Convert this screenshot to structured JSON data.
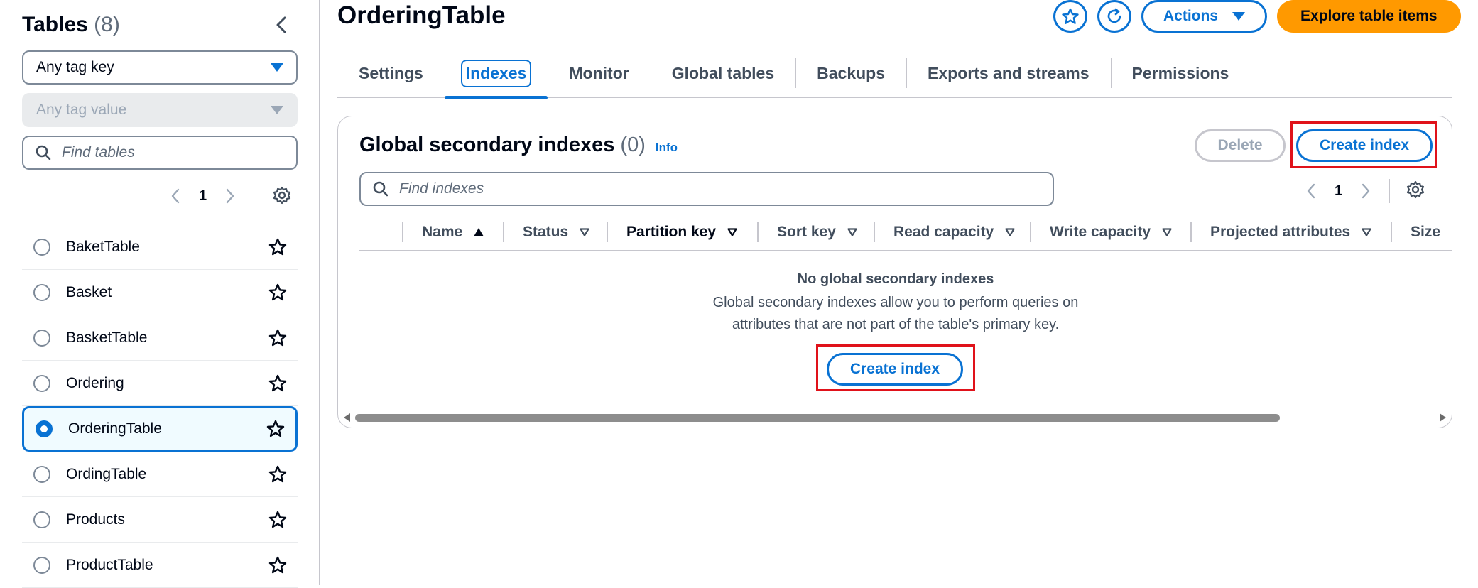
{
  "sidebar": {
    "title": "Tables",
    "count": "(8)",
    "tag_key_select": "Any tag key",
    "tag_value_select": "Any tag value",
    "search_placeholder": "Find tables",
    "page": "1",
    "tables": [
      {
        "name": "BaketTable",
        "selected": false
      },
      {
        "name": "Basket",
        "selected": false
      },
      {
        "name": "BasketTable",
        "selected": false
      },
      {
        "name": "Ordering",
        "selected": false
      },
      {
        "name": "OrderingTable",
        "selected": true
      },
      {
        "name": "OrdingTable",
        "selected": false
      },
      {
        "name": "Products",
        "selected": false
      },
      {
        "name": "ProductTable",
        "selected": false
      }
    ]
  },
  "header": {
    "title": "OrderingTable",
    "actions_label": "Actions",
    "explore_label": "Explore table items"
  },
  "tabs": [
    "Settings",
    "Indexes",
    "Monitor",
    "Global tables",
    "Backups",
    "Exports and streams",
    "Permissions"
  ],
  "active_tab": "Indexes",
  "gsi": {
    "title": "Global secondary indexes",
    "count": "(0)",
    "info": "Info",
    "delete_label": "Delete",
    "create_label": "Create index",
    "search_placeholder": "Find indexes",
    "page": "1",
    "columns": [
      "Name",
      "Status",
      "Partition key",
      "Sort key",
      "Read capacity",
      "Write capacity",
      "Projected attributes",
      "Size"
    ],
    "empty_title": "No global secondary indexes",
    "empty_line1": "Global secondary indexes allow you to perform queries on",
    "empty_line2": "attributes that are not part of the table's primary key.",
    "empty_create_label": "Create index"
  },
  "colors": {
    "accent": "#0972d3",
    "primary_button": "#ff9900",
    "highlight_box": "#e0121a"
  }
}
